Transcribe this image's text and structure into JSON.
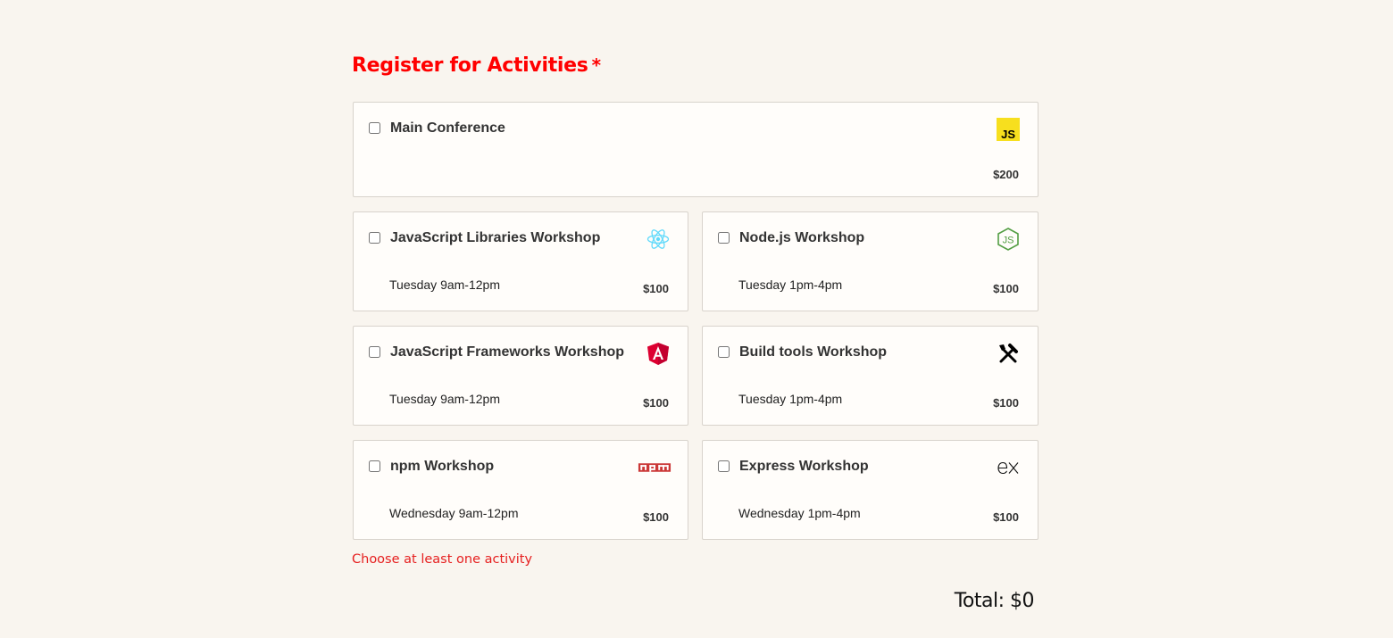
{
  "activities": {
    "legend": "Register for Activities",
    "required_mark": "*",
    "items": [
      {
        "name": "Main Conference",
        "time": "",
        "cost": "$200",
        "icon": "javascript-icon"
      },
      {
        "name": "JavaScript Libraries Workshop",
        "time": "Tuesday 9am-12pm",
        "cost": "$100",
        "icon": "react-icon"
      },
      {
        "name": "Node.js Workshop",
        "time": "Tuesday 1pm-4pm",
        "cost": "$100",
        "icon": "nodejs-icon"
      },
      {
        "name": "JavaScript Frameworks Workshop",
        "time": "Tuesday 9am-12pm",
        "cost": "$100",
        "icon": "angular-icon"
      },
      {
        "name": "Build tools Workshop",
        "time": "Tuesday 1pm-4pm",
        "cost": "$100",
        "icon": "tools-icon"
      },
      {
        "name": "npm Workshop",
        "time": "Wednesday 9am-12pm",
        "cost": "$100",
        "icon": "npm-icon"
      },
      {
        "name": "Express Workshop",
        "time": "Wednesday 1pm-4pm",
        "cost": "$100",
        "icon": "express-icon"
      }
    ],
    "error_hint": "Choose at least one activity",
    "total": "Total: $0"
  },
  "colors": {
    "background": "#f9f5ef",
    "legend": "#ff0000",
    "error": "#e62020",
    "js_yellow": "#f7df1e",
    "react_cyan": "#61dafb",
    "node_green": "#539e43",
    "angular_red": "#dd0031",
    "npm_red": "#cb3837"
  }
}
